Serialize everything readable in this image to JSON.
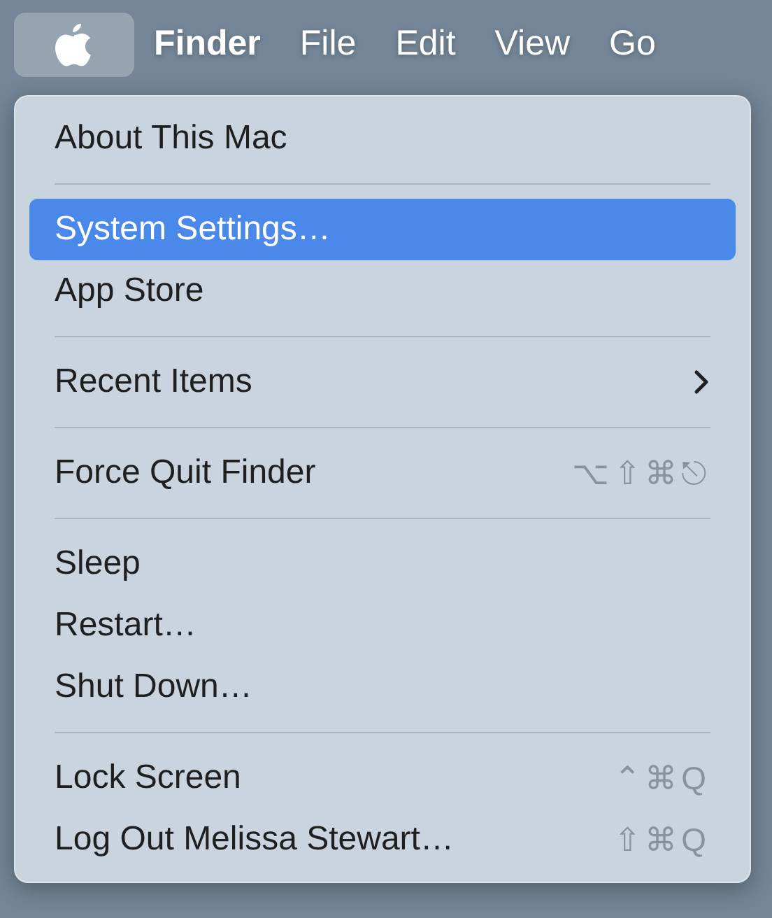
{
  "menu_bar": {
    "items": [
      {
        "kind": "logo",
        "selected": true
      },
      {
        "kind": "app",
        "label": "Finder",
        "selected": false
      },
      {
        "kind": "menu",
        "label": "File",
        "selected": false
      },
      {
        "kind": "menu",
        "label": "Edit",
        "selected": false
      },
      {
        "kind": "menu",
        "label": "View",
        "selected": false
      },
      {
        "kind": "menu",
        "label": "Go",
        "selected": false
      }
    ]
  },
  "menu": {
    "items": [
      {
        "kind": "item",
        "label": "About This Mac",
        "selected": false
      },
      {
        "kind": "separator"
      },
      {
        "kind": "item",
        "label": "System Settings…",
        "selected": true
      },
      {
        "kind": "item",
        "label": "App Store",
        "selected": false
      },
      {
        "kind": "separator"
      },
      {
        "kind": "item",
        "label": "Recent Items",
        "selected": false,
        "submenu": true
      },
      {
        "kind": "separator"
      },
      {
        "kind": "item",
        "label": "Force Quit Finder",
        "selected": false,
        "shortcut": "⌥⇧⌘⎋"
      },
      {
        "kind": "separator"
      },
      {
        "kind": "item",
        "label": "Sleep",
        "selected": false
      },
      {
        "kind": "item",
        "label": "Restart…",
        "selected": false
      },
      {
        "kind": "item",
        "label": "Shut Down…",
        "selected": false
      },
      {
        "kind": "separator"
      },
      {
        "kind": "item",
        "label": "Lock Screen",
        "selected": false,
        "shortcut": "⌃⌘Q"
      },
      {
        "kind": "item",
        "label": "Log Out Melissa Stewart…",
        "selected": false,
        "shortcut": "⇧⌘Q"
      }
    ]
  }
}
